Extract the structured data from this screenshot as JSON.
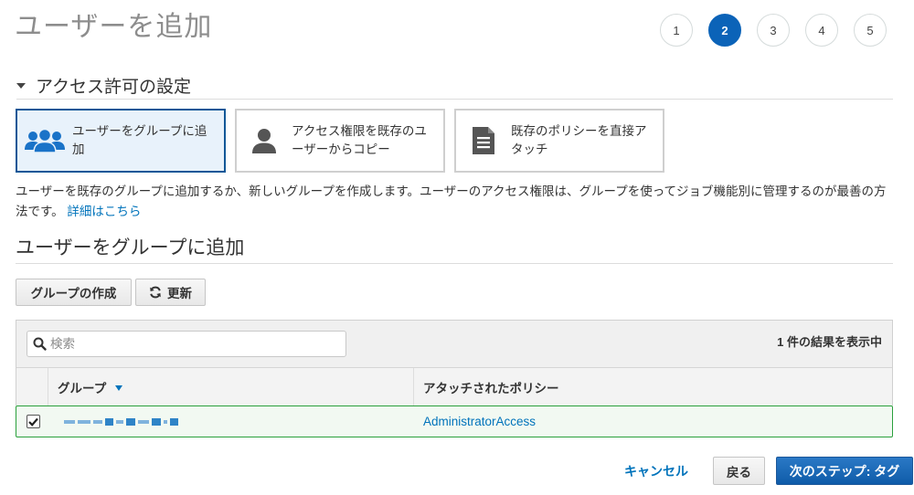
{
  "page": {
    "title": "ユーザーを追加"
  },
  "wizard": {
    "steps": [
      {
        "label": "1",
        "active": false
      },
      {
        "label": "2",
        "active": true
      },
      {
        "label": "3",
        "active": false
      },
      {
        "label": "4",
        "active": false
      },
      {
        "label": "5",
        "active": false
      }
    ]
  },
  "permissions": {
    "section_title": "アクセス許可の設定",
    "options": [
      {
        "label": "ユーザーをグループに追加",
        "icon": "users-group-icon",
        "selected": true
      },
      {
        "label": "アクセス権限を既存のユーザーからコピー",
        "icon": "user-icon",
        "selected": false
      },
      {
        "label": "既存のポリシーを直接アタッチ",
        "icon": "document-icon",
        "selected": false
      }
    ],
    "description": "ユーザーを既存のグループに追加するか、新しいグループを作成します。ユーザーのアクセス権限は、グループを使ってジョブ機能別に管理するのが最善の方法です。",
    "learn_more": "詳細はこちら"
  },
  "group_section": {
    "title": "ユーザーをグループに追加",
    "create_button": "グループの作成",
    "refresh_button": "更新",
    "refresh_icon": "refresh-icon",
    "search_placeholder": "検索",
    "result_count": "1 件の結果を表示中",
    "columns": {
      "group": "グループ",
      "policy": "アタッチされたポリシー"
    },
    "rows": [
      {
        "checked": true,
        "group_redacted": true,
        "policy": "AdministratorAccess"
      }
    ]
  },
  "footer": {
    "cancel": "キャンセル",
    "back": "戻る",
    "next": "次のステップ: タグ"
  },
  "colors": {
    "primary": "#0b63b8",
    "link": "#0073bb",
    "selected_border": "#0f5797",
    "selected_bg": "#e8f2fb",
    "row_border": "#2aa03c"
  }
}
